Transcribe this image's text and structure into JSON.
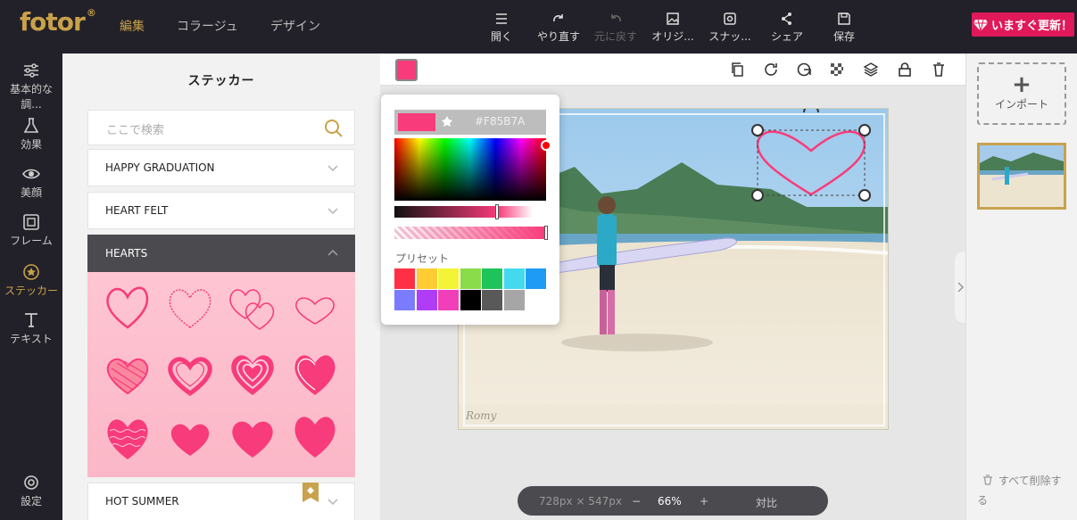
{
  "brand": {
    "logo": "fotor",
    "mark": "®"
  },
  "nav": {
    "items": [
      "編集",
      "コラージュ",
      "デザイン"
    ],
    "active": 0
  },
  "toolbar": {
    "open": "開く",
    "redo": "やり直す",
    "undo": "元に戻す",
    "original": "オリジ...",
    "snapshot": "スナッ...",
    "share": "シェア",
    "save": "保存"
  },
  "upgrade": {
    "label": "いますぐ更新！"
  },
  "rail": {
    "items": [
      "基本的な調...",
      "効果",
      "美顔",
      "フレーム",
      "ステッカー",
      "テキスト"
    ],
    "settings": "設定",
    "active": 4
  },
  "sticker_panel": {
    "title": "ステッカー",
    "search_placeholder": "ここで検索",
    "categories": [
      "HAPPY GRADUATION",
      "HEART FELT",
      "HEARTS",
      "HOT SUMMER"
    ],
    "open_category": "HEARTS"
  },
  "color_picker": {
    "hex": "#F85B7A",
    "preset_label": "プリセット",
    "selected_color": "#f83b7a",
    "presets": [
      "#ff3046",
      "#ffcc33",
      "#f4f436",
      "#8bdc4a",
      "#1ec45a",
      "#44d9ef",
      "#1e9cf5",
      "#7b7bff",
      "#b03cf7",
      "#f03fb8",
      "#000000",
      "#595959",
      "#a6a6a6"
    ]
  },
  "zoom": {
    "dimensions": "728px × 547px",
    "minus": "−",
    "value": "66%",
    "plus": "+",
    "compare": "対比"
  },
  "right_panel": {
    "import": "インポート",
    "delete_all": "すべて削除する"
  },
  "colors": {
    "accent": "#c9a14a",
    "topbar": "#222129",
    "upgrade": "#e0195a",
    "heart": "#f83b7a"
  }
}
